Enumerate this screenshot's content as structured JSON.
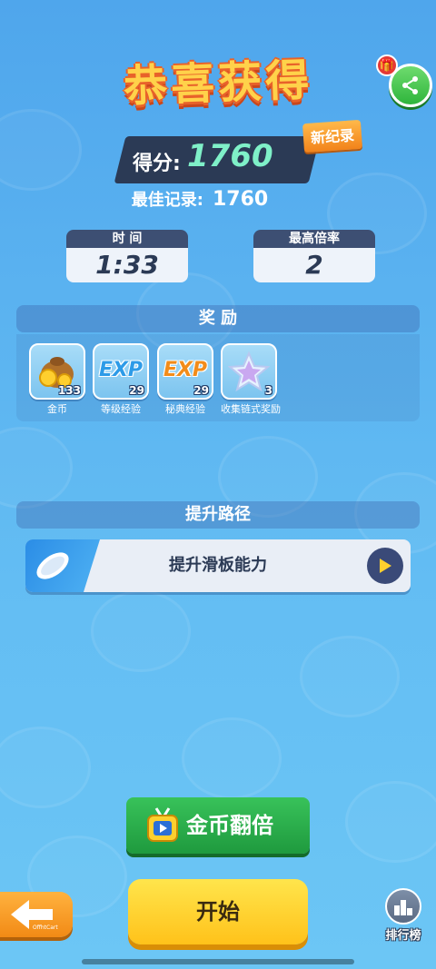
{
  "header": {
    "title": "恭喜获得"
  },
  "score": {
    "label": "得分:",
    "value": "1760",
    "new_record": "新纪录"
  },
  "best": {
    "label": "最佳记录:",
    "value": "1760"
  },
  "stats": [
    {
      "label": "时 间",
      "value": "1:33"
    },
    {
      "label": "最高倍率",
      "value": "2"
    }
  ],
  "rewards": {
    "title": "奖 励",
    "items": [
      {
        "name": "金币",
        "count": "133",
        "icon": "coin-bag-icon"
      },
      {
        "name": "等级经验",
        "count": "29",
        "icon": "exp-icon",
        "text": "EXP"
      },
      {
        "name": "秘典经验",
        "count": "29",
        "icon": "exp-icon",
        "text": "EXP"
      },
      {
        "name": "收集链式奖励",
        "count": "3",
        "icon": "star-icon"
      }
    ]
  },
  "upgrade": {
    "title": "提升路径",
    "item_label": "提升滑板能力"
  },
  "buttons": {
    "double_coins": "金币翻倍",
    "start": "开始",
    "back_tag": "OffhtCart",
    "leaderboard": "排行榜"
  },
  "colors": {
    "title": "#ffd24a",
    "score_value": "#7ff0c8",
    "start": "#ffd02e",
    "double": "#2aae4c"
  }
}
